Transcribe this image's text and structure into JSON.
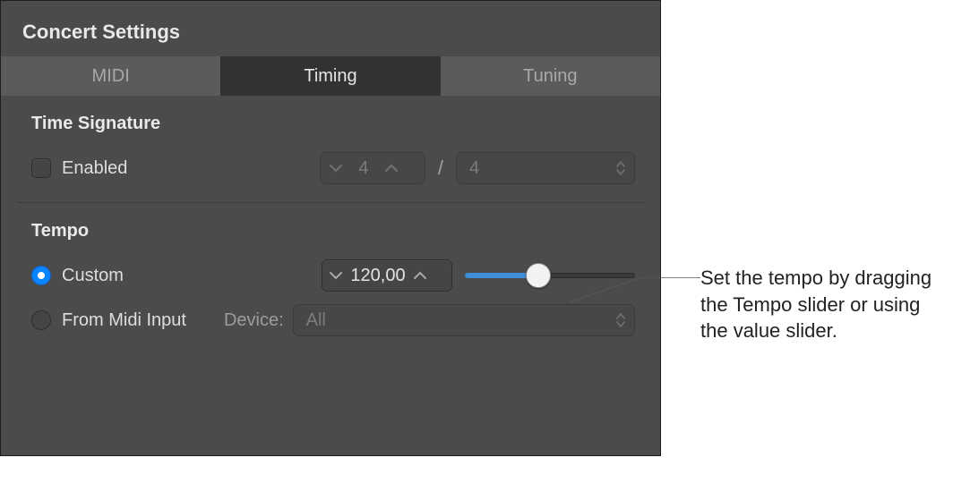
{
  "panel": {
    "title": "Concert Settings",
    "tabs": [
      "MIDI",
      "Timing",
      "Tuning"
    ],
    "active_tab": "Timing"
  },
  "time_signature": {
    "section_title": "Time Signature",
    "enabled_label": "Enabled",
    "numerator": "4",
    "denominator": "4"
  },
  "tempo": {
    "section_title": "Tempo",
    "custom_label": "Custom",
    "from_midi_label": "From Midi Input",
    "value": "120,00",
    "device_label": "Device:",
    "device_value": "All"
  },
  "callout": {
    "text": "Set the tempo by dragging the Tempo slider or using the value slider."
  }
}
